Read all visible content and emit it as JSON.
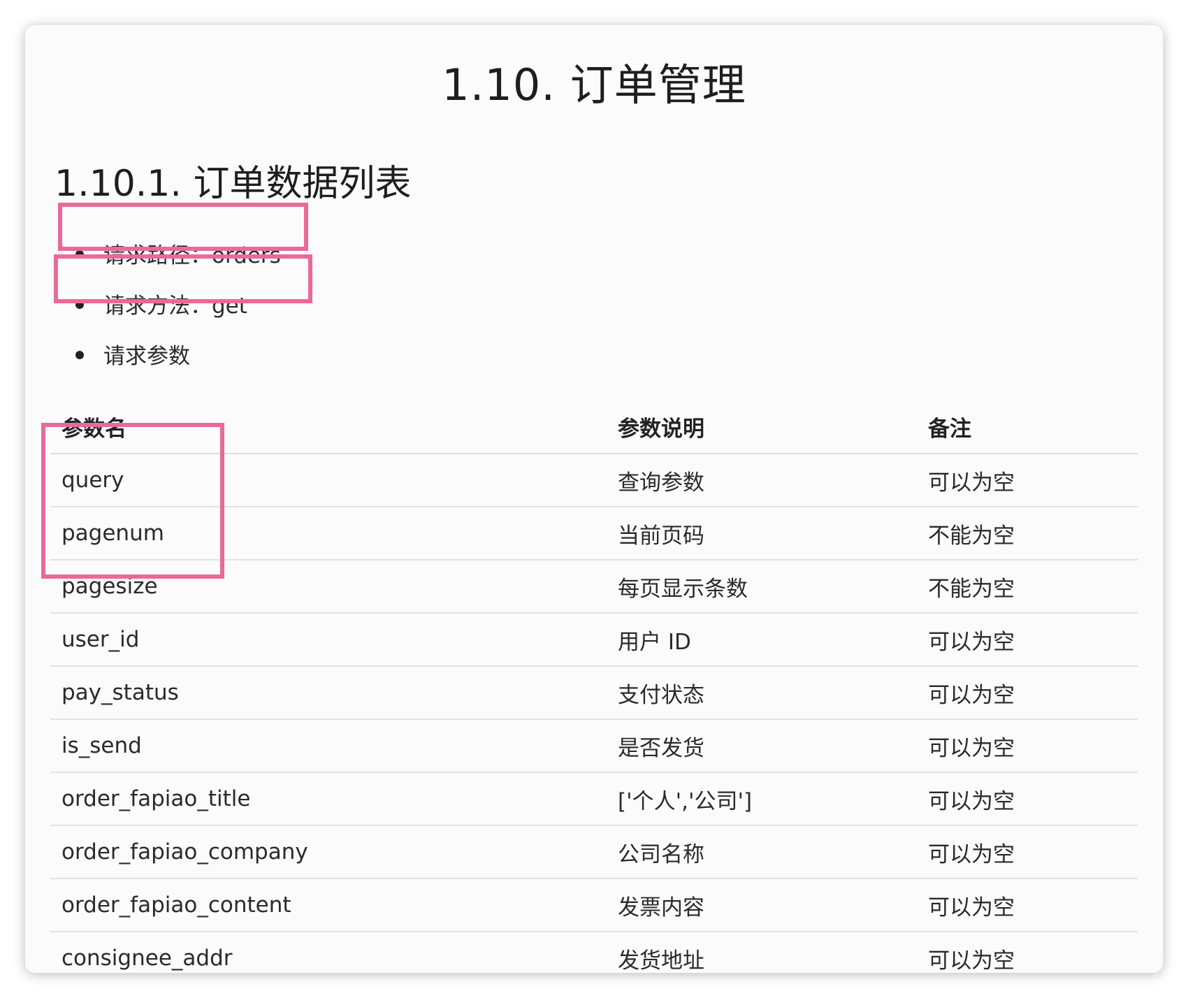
{
  "section_title": "1.10. 订单管理",
  "subsection_title": "1.10.1. 订单数据列表",
  "bullets": {
    "path": "请求路径：orders",
    "method": "请求方法：get",
    "params": "请求参数"
  },
  "table": {
    "headers": [
      "参数名",
      "参数说明",
      "备注"
    ],
    "rows": [
      [
        "query",
        "查询参数",
        "可以为空"
      ],
      [
        "pagenum",
        "当前页码",
        "不能为空"
      ],
      [
        "pagesize",
        "每页显示条数",
        "不能为空"
      ],
      [
        "user_id",
        "用户 ID",
        "可以为空"
      ],
      [
        "pay_status",
        "支付状态",
        "可以为空"
      ],
      [
        "is_send",
        "是否发货",
        "可以为空"
      ],
      [
        "order_fapiao_title",
        "['个人','公司']",
        "可以为空"
      ],
      [
        "order_fapiao_company",
        "公司名称",
        "可以为空"
      ],
      [
        "order_fapiao_content",
        "发票内容",
        "可以为空"
      ],
      [
        "consignee_addr",
        "发货地址",
        "可以为空"
      ]
    ]
  },
  "colors": {
    "highlight": "#e8699a"
  }
}
